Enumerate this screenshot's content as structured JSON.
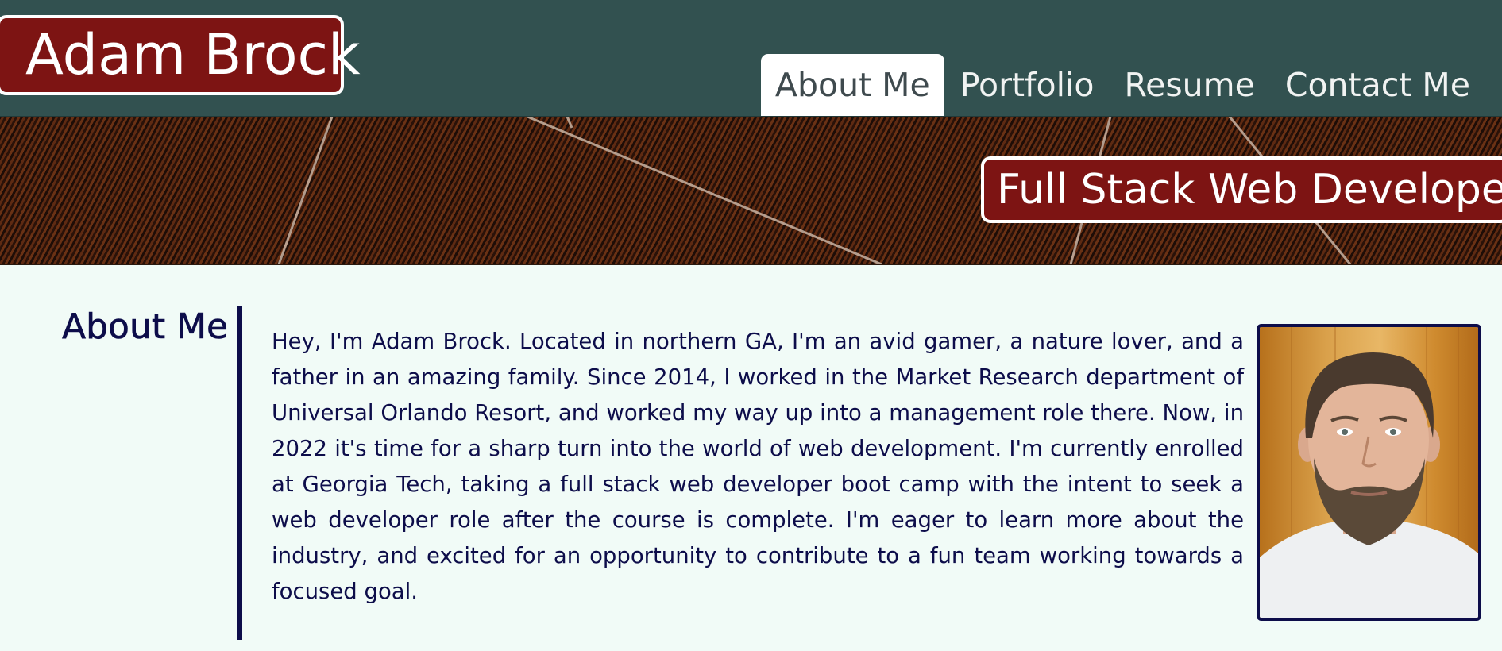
{
  "header": {
    "brand": "Adam Brock",
    "nav": [
      {
        "label": "About Me",
        "active": true
      },
      {
        "label": "Portfolio",
        "active": false
      },
      {
        "label": "Resume",
        "active": false
      },
      {
        "label": "Contact Me",
        "active": false
      }
    ]
  },
  "banner": {
    "tagline": "Full Stack Web Developer"
  },
  "about": {
    "heading": "About Me",
    "text": "Hey, I'm Adam Brock. Located in northern GA, I'm an avid gamer, a nature lover, and a father in an amazing family. Since 2014, I worked in the Market Research department of Universal Orlando Resort, and worked my way up into a management role there. Now, in 2022 it's time for a sharp turn into the world of web development. I'm currently enrolled at Georgia Tech, taking a full stack web developer boot camp with the intent to seek a web developer role after the course is complete. I'm eager to learn more about the industry, and excited for an opportunity to contribute to a fun team working towards a focused goal."
  },
  "colors": {
    "header_bg": "#325150",
    "accent_red": "#7d1413",
    "text_navy": "#0d0d4a",
    "page_bg": "#f1fbf7"
  }
}
